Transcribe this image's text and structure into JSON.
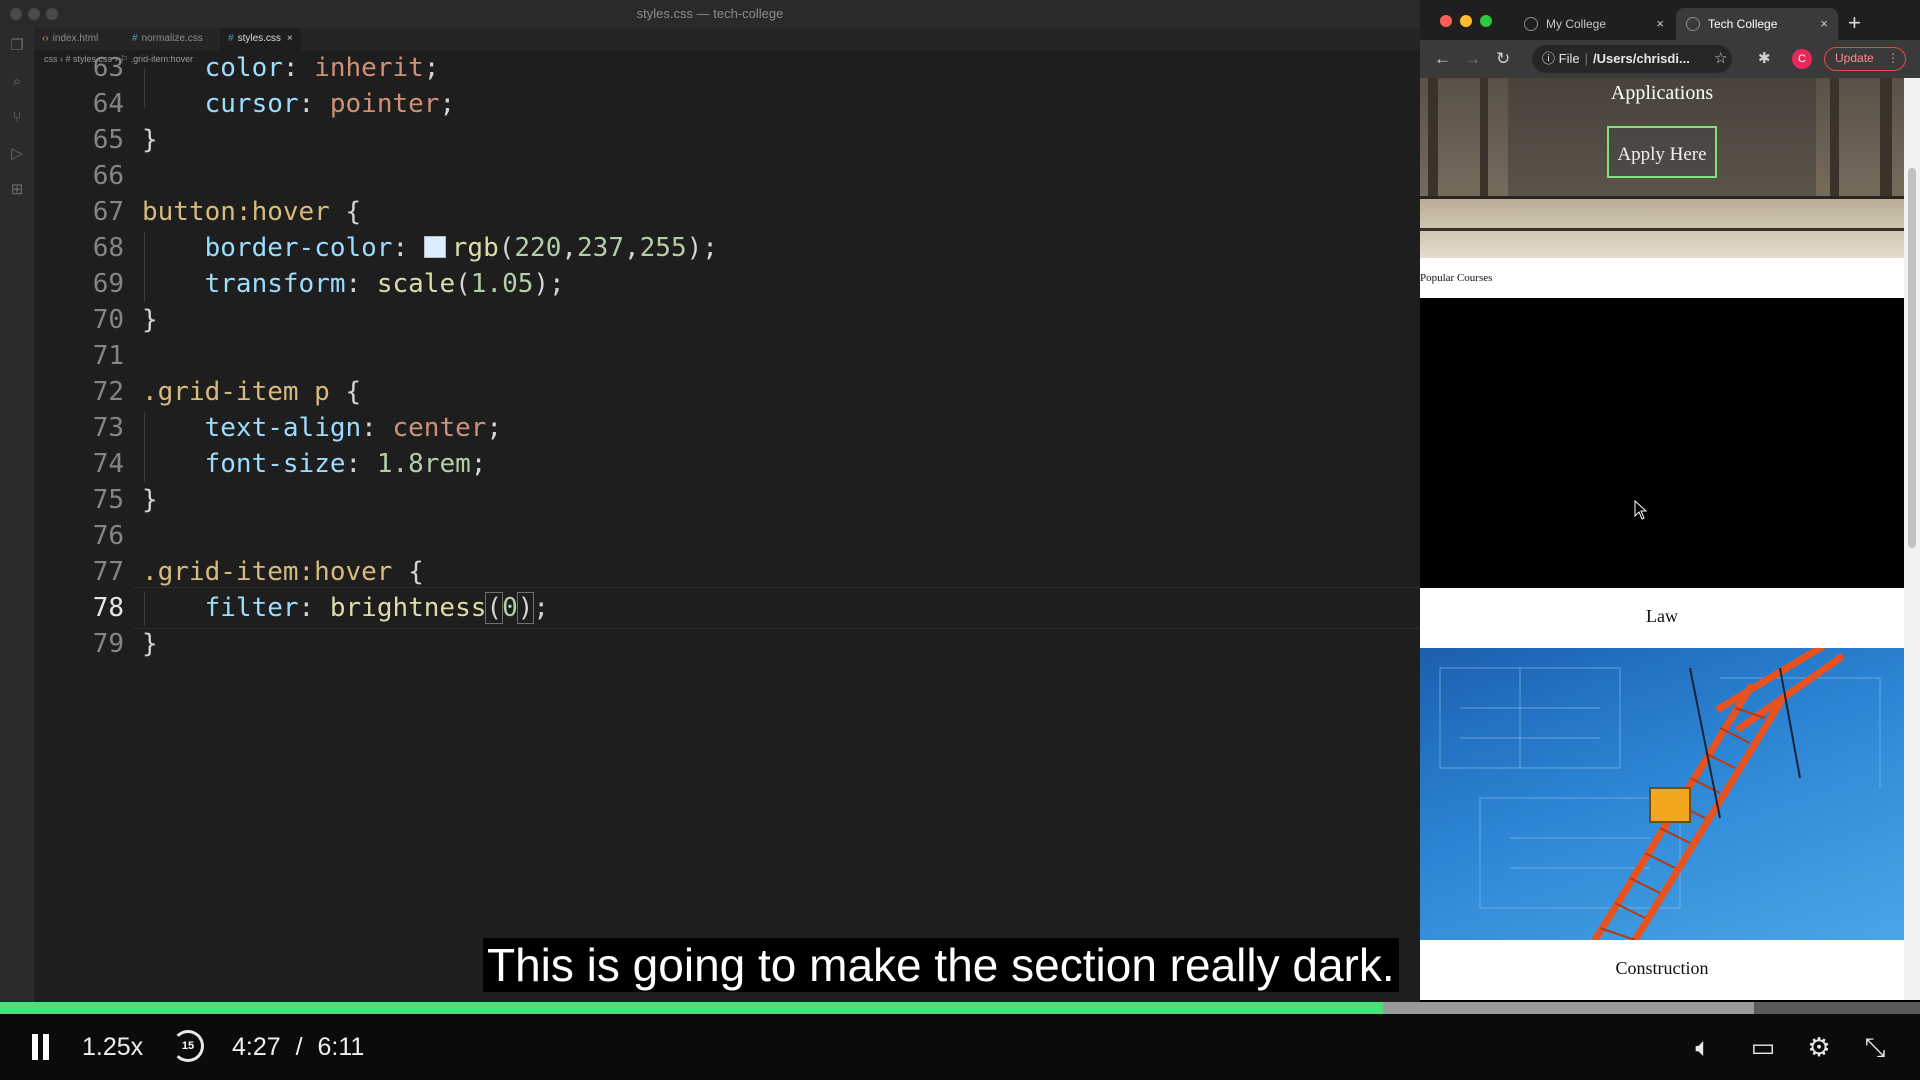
{
  "editor": {
    "window_title": "styles.css — tech-college",
    "tabs": [
      {
        "label": "index.html",
        "icon": "html-icon"
      },
      {
        "label": "normalize.css",
        "icon": "css-icon"
      },
      {
        "label": "styles.css",
        "icon": "css-icon",
        "close": "×"
      }
    ],
    "breadcrumb": "css  ›  # styles.css  ›  ⚐ .grid-item:hover",
    "current_line": "78"
  },
  "browser": {
    "tabs": [
      {
        "label": "My College",
        "close": "×"
      },
      {
        "label": "Tech College",
        "close": "×"
      }
    ],
    "new_tab": "+",
    "omnibox": {
      "scheme_label": "File",
      "path": "/Users/chrisdi..."
    },
    "profile_initial": "C",
    "update_label": "Update",
    "page": {
      "hero_title": "Applications",
      "apply_button": "Apply Here",
      "section_title": "Popular Courses",
      "courses": [
        {
          "label": "Law"
        },
        {
          "label": "Construction"
        }
      ]
    }
  },
  "player": {
    "subtitle": "This is going to make the section really dark.",
    "speed": "1.25x",
    "rewind_seconds": "15",
    "current_time": "4:27",
    "time_separator": "/",
    "total_time": "6:11",
    "progress": 0.7203,
    "buffered": 0.9135
  },
  "colors": {
    "progress": "#4be17a",
    "editor_bg": "#1e1e1e",
    "swatch": "#dcedff"
  }
}
